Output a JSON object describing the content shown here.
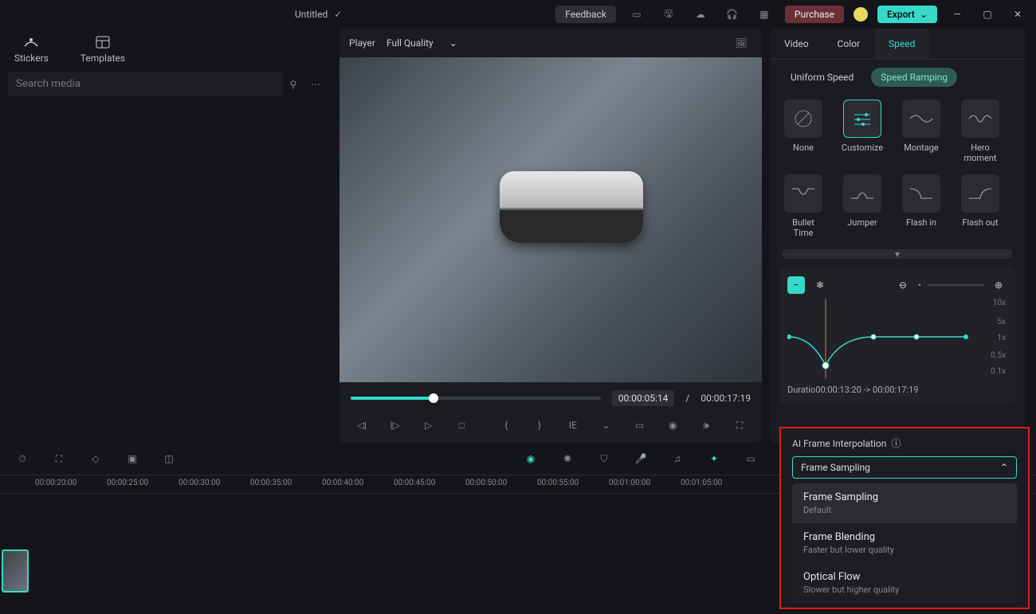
{
  "topbar": {
    "title": "Untitled",
    "feedback": "Feedback",
    "purchase": "Purchase",
    "export": "Export"
  },
  "left": {
    "tab1": "Stickers",
    "tab2": "Templates",
    "search_placeholder": "Search media"
  },
  "player": {
    "label": "Player",
    "quality": "Full Quality",
    "current": "00:00:05:14",
    "sep": "/",
    "total": "00:00:17:19"
  },
  "right": {
    "tabs": {
      "video": "Video",
      "color": "Color",
      "speed": "Speed"
    },
    "subtabs": {
      "uniform": "Uniform Speed",
      "ramp": "Speed Ramping"
    },
    "presets": [
      "None",
      "Customize",
      "Montage",
      "Hero moment",
      "Bullet Time",
      "Jumper",
      "Flash in",
      "Flash out"
    ],
    "ylabels": [
      "10x",
      "5x",
      "1x",
      "0.5x",
      "0.1x"
    ],
    "duration": "Duratio00:00:13:20 -> 00:00:17:19"
  },
  "timeline": {
    "marks": [
      "00:00:20:00",
      "00:00:25:00",
      "00:00:30:00",
      "00:00:35:00",
      "00:00:40:00",
      "00:00:45:00",
      "00:00:50:00",
      "00:00:55:00",
      "00:01:00:00",
      "00:01:05:00"
    ]
  },
  "interp": {
    "title": "AI Frame Interpolation",
    "selected": "Frame Sampling",
    "options": [
      {
        "t": "Frame Sampling",
        "d": "Default"
      },
      {
        "t": "Frame Blending",
        "d": "Faster but lower quality"
      },
      {
        "t": "Optical Flow",
        "d": "Slower but higher quality"
      }
    ]
  }
}
